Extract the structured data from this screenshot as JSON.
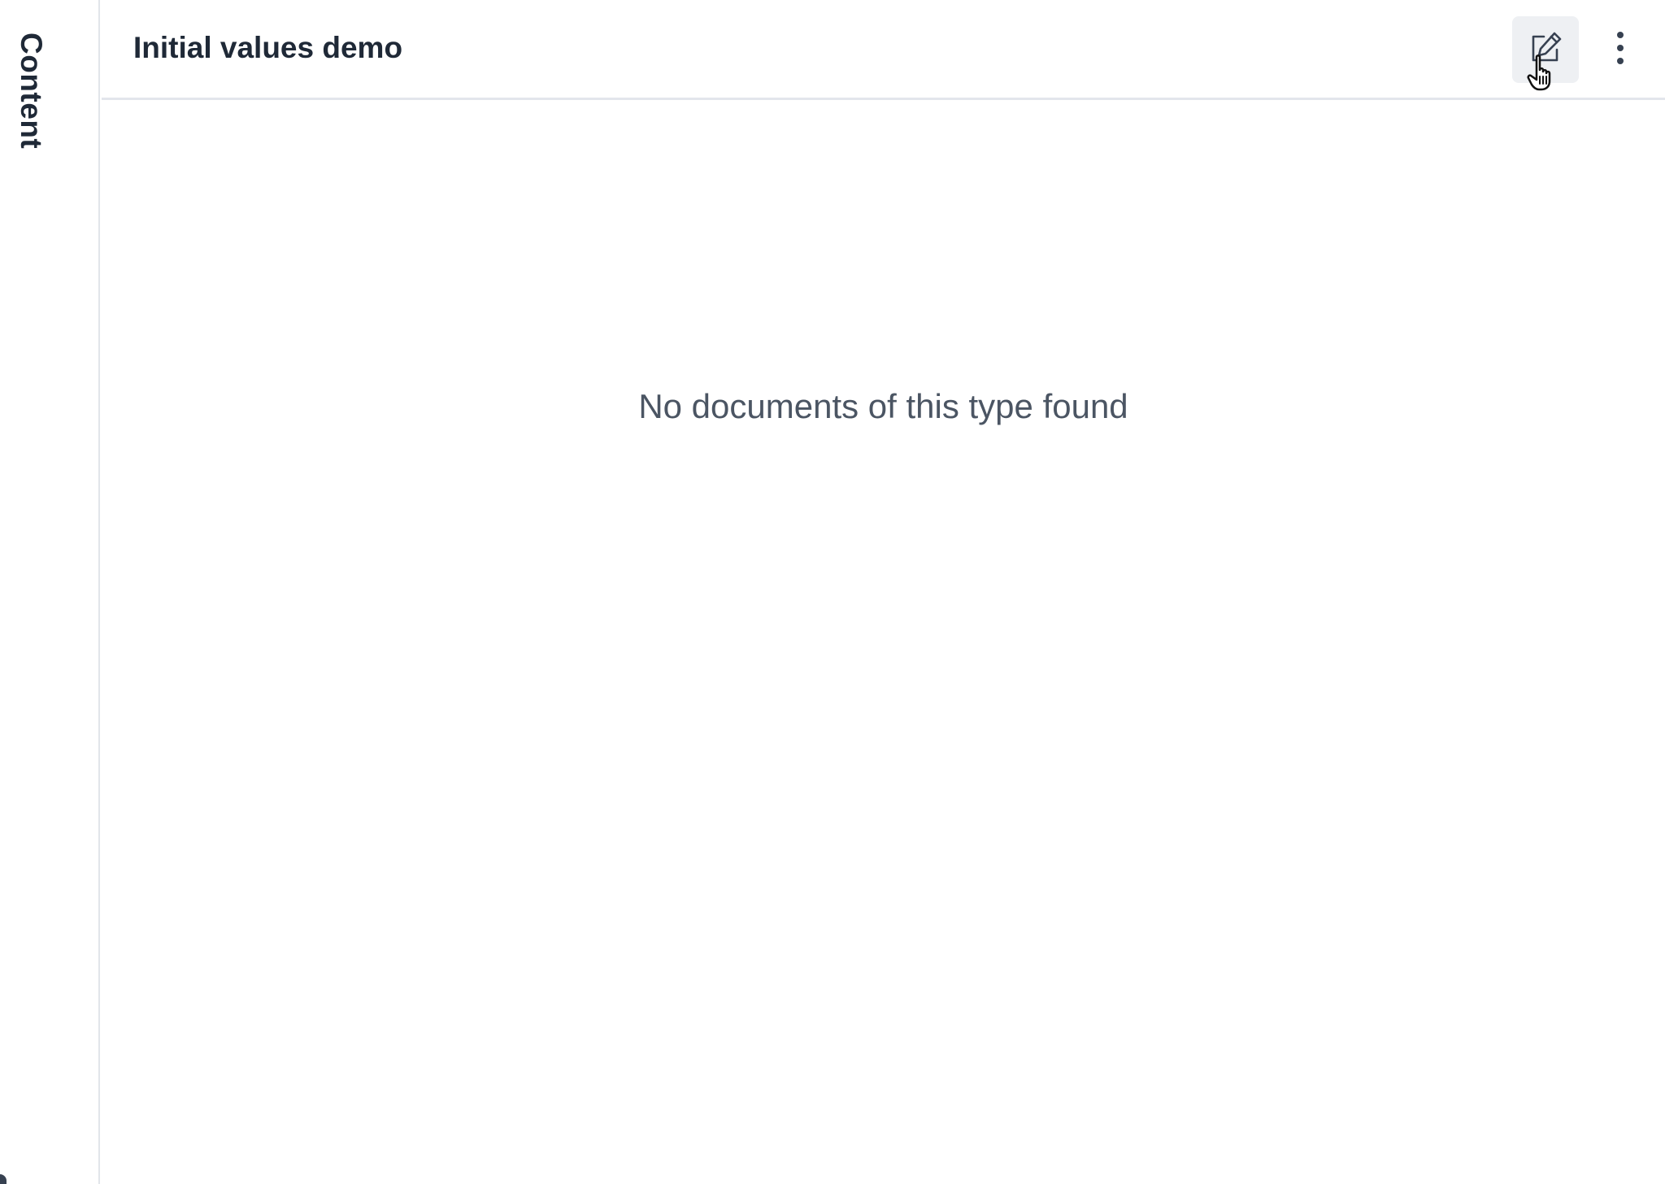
{
  "collapsed_pane": {
    "title": "Content"
  },
  "main_pane": {
    "title": "Initial values demo",
    "actions": {
      "compose_icon": "compose-icon",
      "menu_icon": "vertical-ellipsis-icon"
    },
    "empty_message": "No documents of this type found"
  },
  "colors": {
    "text_primary": "#1f2937",
    "text_secondary": "#4b5563",
    "divider": "#e3e6ec",
    "button_hover_bg": "#eef0f3"
  }
}
